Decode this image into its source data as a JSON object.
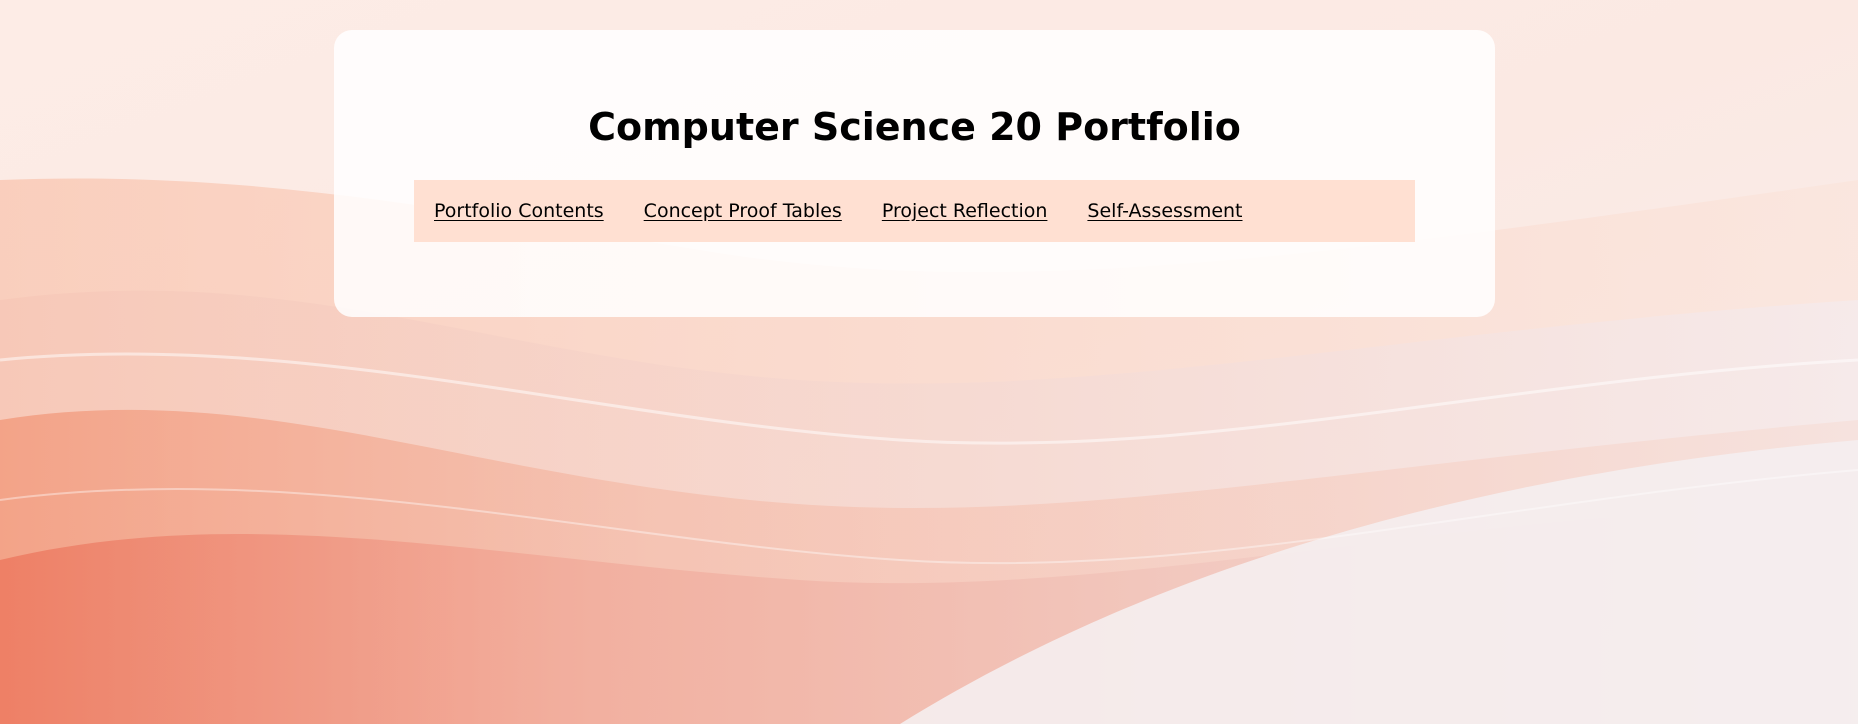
{
  "page": {
    "title": "Computer Science 20 Portfolio"
  },
  "nav": {
    "items": [
      {
        "label": "Portfolio Contents"
      },
      {
        "label": "Concept Proof Tables"
      },
      {
        "label": "Project Reflection"
      },
      {
        "label": "Self-Assessment"
      }
    ]
  },
  "colors": {
    "nav_background": "#ffe0d2",
    "card_background": "#ffffff",
    "accent_waves": "#f4a58a"
  }
}
